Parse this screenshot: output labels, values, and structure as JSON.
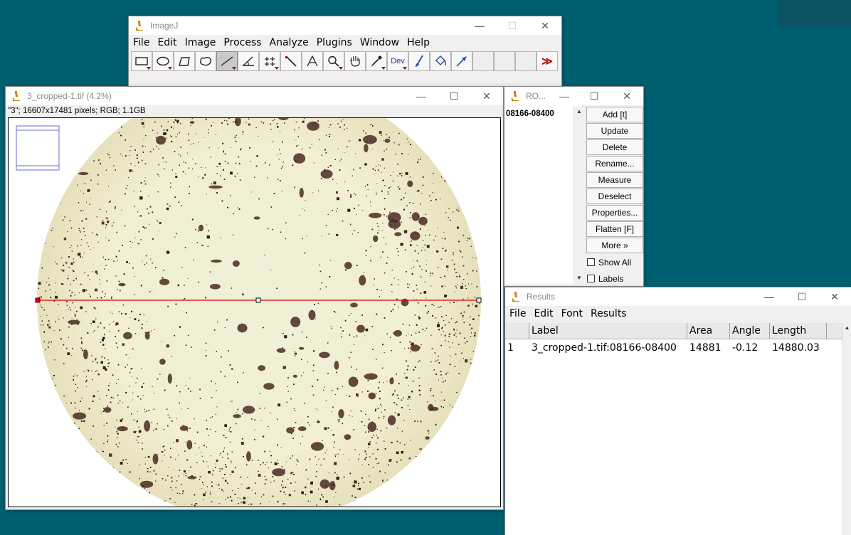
{
  "main_window": {
    "title": "ImageJ",
    "menus": [
      "File",
      "Edit",
      "Image",
      "Process",
      "Analyze",
      "Plugins",
      "Window",
      "Help"
    ],
    "tools": [
      {
        "name": "rectangle-tool",
        "icon": "rectangle-icon",
        "has_menu": true
      },
      {
        "name": "oval-tool",
        "icon": "oval-icon",
        "has_menu": true
      },
      {
        "name": "polygon-tool",
        "icon": "polygon-icon",
        "has_menu": false
      },
      {
        "name": "freehand-tool",
        "icon": "freehand-icon",
        "has_menu": false
      },
      {
        "name": "line-tool",
        "icon": "line-icon",
        "has_menu": true,
        "active": true
      },
      {
        "name": "angle-tool",
        "icon": "angle-icon",
        "has_menu": false
      },
      {
        "name": "point-tool",
        "icon": "multipoint-icon",
        "has_menu": true
      },
      {
        "name": "wand-tool",
        "icon": "wand-icon",
        "has_menu": false
      },
      {
        "name": "text-tool",
        "icon": "text-icon",
        "has_menu": false
      },
      {
        "name": "zoom-tool",
        "icon": "magnifier-icon",
        "has_menu": true
      },
      {
        "name": "hand-tool",
        "icon": "hand-icon",
        "has_menu": false
      },
      {
        "name": "color-picker-tool",
        "icon": "dropper-icon",
        "has_menu": true
      },
      {
        "name": "dev-tool",
        "icon": "dev-icon",
        "label": "Dev",
        "has_menu": true
      },
      {
        "name": "brush-tool",
        "icon": "brush-icon",
        "has_menu": false
      },
      {
        "name": "flood-fill-tool",
        "icon": "flood-fill-icon",
        "has_menu": false
      },
      {
        "name": "arrow-tool",
        "icon": "arrow-icon",
        "has_menu": false
      }
    ],
    "more_tools_symbol": "≫"
  },
  "image_window": {
    "title": "3_cropped-1.tif (4.2%)",
    "info": "\"3\"; 16607x17481 pixels; RGB; 1.1GB",
    "line_roi": {
      "color": "#e00000"
    }
  },
  "roi_manager": {
    "title": "RO...",
    "items": [
      "08166-08400"
    ],
    "buttons": [
      "Add [t]",
      "Update",
      "Delete",
      "Rename...",
      "Measure",
      "Deselect",
      "Properties...",
      "Flatten [F]",
      "More »"
    ],
    "checkboxes": [
      "Show All",
      "Labels"
    ]
  },
  "results": {
    "title": "Results",
    "menus": [
      "File",
      "Edit",
      "Font",
      "Results"
    ],
    "columns": [
      "",
      "Label",
      "Area",
      "Angle",
      "Length"
    ],
    "rows": [
      [
        "1",
        "3_cropped-1.tif:08166-08400",
        "14881",
        "-0.12",
        "14880.03"
      ]
    ]
  },
  "colors": {
    "desktop": "#005f6e",
    "image_background": "#f3f0d8",
    "speckle": "#3a2418"
  }
}
